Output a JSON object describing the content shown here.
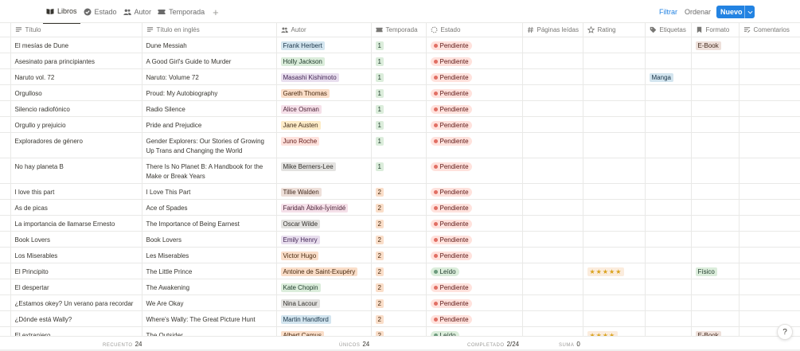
{
  "views": [
    {
      "label": "Libros",
      "icon": "book-open-icon",
      "active": true
    },
    {
      "label": "Estado",
      "icon": "check-circle-icon",
      "active": false
    },
    {
      "label": "Autor",
      "icon": "people-icon",
      "active": false
    },
    {
      "label": "Temporada",
      "icon": "ticket-icon",
      "active": false
    }
  ],
  "add_view_label": "+",
  "actions": {
    "filter": "Filtrar",
    "sort": "Ordenar",
    "new": "Nuevo"
  },
  "columns": [
    {
      "label": "Título",
      "icon": "text-lines-icon"
    },
    {
      "label": "Título en inglés",
      "icon": "text-lines-icon"
    },
    {
      "label": "Autor",
      "icon": "people-icon"
    },
    {
      "label": "Temporada",
      "icon": "ticket-icon"
    },
    {
      "label": "Estado",
      "icon": "status-dashed-circle-icon"
    },
    {
      "label": "Páginas leídas",
      "icon": "hash-icon"
    },
    {
      "label": "Rating",
      "icon": "star-icon"
    },
    {
      "label": "Etiquetas",
      "icon": "tag-icon"
    },
    {
      "label": "Formato",
      "icon": "bookmark-icon"
    },
    {
      "label": "Comentarios",
      "icon": "comment-lines-icon"
    }
  ],
  "colors": {
    "author_tags": {
      "blue": {
        "bg": "#d3e5ef",
        "fg": "#183347"
      },
      "green": {
        "bg": "#dbeddb",
        "fg": "#1c3829"
      },
      "purple": {
        "bg": "#e8deee",
        "fg": "#412454"
      },
      "orange": {
        "bg": "#fadec9",
        "fg": "#49290e"
      },
      "pink": {
        "bg": "#f5e0e9",
        "fg": "#4c2337"
      },
      "yellow": {
        "bg": "#fdecc8",
        "fg": "#402c1b"
      },
      "red": {
        "bg": "#ffe2dd",
        "fg": "#5d1715"
      },
      "gray": {
        "bg": "#e3e2e0",
        "fg": "#32302c"
      },
      "brown": {
        "bg": "#eee0da",
        "fg": "#442a1e"
      }
    },
    "season": {
      "1": {
        "bg": "#dbeddb",
        "fg": "#1c3829"
      },
      "2": {
        "bg": "#fadec9",
        "fg": "#49290e"
      }
    },
    "status": {
      "Pendiente": {
        "bg": "#ffe2dd",
        "fg": "#5d1715",
        "dot": "#e16f64"
      },
      "Leído": {
        "bg": "#dbeddb",
        "fg": "#1c3829",
        "dot": "#6c9b7d"
      }
    },
    "label_tag": {
      "bg": "#d3e5ef",
      "fg": "#183347"
    },
    "format": {
      "E-Book": {
        "bg": "#eee0da",
        "fg": "#442a1e"
      },
      "Físico": {
        "bg": "#dbeddb",
        "fg": "#1c3829"
      }
    }
  },
  "rows": [
    {
      "titulo": "El mesías de Dune",
      "ingles": "Dune Messiah",
      "autor": "Frank Herbert",
      "autor_color": "blue",
      "temporada": "1",
      "estado": "Pendiente",
      "paginas": "",
      "rating": "",
      "etiquetas": "",
      "formato": "E-Book",
      "comentarios": ""
    },
    {
      "titulo": "Asesinato para principiantes",
      "ingles": "A Good Girl's Guide to Murder",
      "autor": "Holly Jackson",
      "autor_color": "green",
      "temporada": "1",
      "estado": "Pendiente",
      "paginas": "",
      "rating": "",
      "etiquetas": "",
      "formato": "",
      "comentarios": ""
    },
    {
      "titulo": "Naruto vol. 72",
      "ingles": "Naruto: Volume 72",
      "autor": "Masashi Kishimoto",
      "autor_color": "purple",
      "temporada": "1",
      "estado": "Pendiente",
      "paginas": "",
      "rating": "",
      "etiquetas": "Manga",
      "formato": "",
      "comentarios": ""
    },
    {
      "titulo": "Orgulloso",
      "ingles": "Proud: My Autobiography",
      "autor": "Gareth Thomas",
      "autor_color": "orange",
      "temporada": "1",
      "estado": "Pendiente",
      "paginas": "",
      "rating": "",
      "etiquetas": "",
      "formato": "",
      "comentarios": ""
    },
    {
      "titulo": "Silencio radiofónico",
      "ingles": "Radio Silence",
      "autor": "Alice Osman",
      "autor_color": "pink",
      "temporada": "1",
      "estado": "Pendiente",
      "paginas": "",
      "rating": "",
      "etiquetas": "",
      "formato": "",
      "comentarios": ""
    },
    {
      "titulo": "Orgullo y prejuicio",
      "ingles": "Pride and Prejudice",
      "autor": "Jane Austen",
      "autor_color": "yellow",
      "temporada": "1",
      "estado": "Pendiente",
      "paginas": "",
      "rating": "",
      "etiquetas": "",
      "formato": "",
      "comentarios": ""
    },
    {
      "titulo": "Exploradores de género",
      "ingles": "Gender Explorers: Our Stories of Growing Up Trans and Changing the World",
      "autor": "Juno Roche",
      "autor_color": "red",
      "temporada": "1",
      "estado": "Pendiente",
      "paginas": "",
      "rating": "",
      "etiquetas": "",
      "formato": "",
      "comentarios": "",
      "tall": true
    },
    {
      "titulo": "No hay planeta B",
      "ingles": "There Is No Planet B: A Handbook for the Make or Break Years",
      "autor": "Mike Berners-Lee",
      "autor_color": "gray",
      "temporada": "1",
      "estado": "Pendiente",
      "paginas": "",
      "rating": "",
      "etiquetas": "",
      "formato": "",
      "comentarios": "",
      "tall": true
    },
    {
      "titulo": "I love this part",
      "ingles": "I Love This Part",
      "autor": "Tillie Walden",
      "autor_color": "brown",
      "temporada": "2",
      "estado": "Pendiente",
      "paginas": "",
      "rating": "",
      "etiquetas": "",
      "formato": "",
      "comentarios": ""
    },
    {
      "titulo": "As de picas",
      "ingles": "Ace of Spades",
      "autor": "Faridah Àbíké-Íyímídé",
      "autor_color": "pink",
      "temporada": "2",
      "estado": "Pendiente",
      "paginas": "",
      "rating": "",
      "etiquetas": "",
      "formato": "",
      "comentarios": ""
    },
    {
      "titulo": "La importancia de llamarse Ernesto",
      "ingles": "The Importance of Being Earnest",
      "autor": "Oscar Wilde",
      "autor_color": "gray",
      "temporada": "2",
      "estado": "Pendiente",
      "paginas": "",
      "rating": "",
      "etiquetas": "",
      "formato": "",
      "comentarios": ""
    },
    {
      "titulo": "Book Lovers",
      "ingles": "Book Lovers",
      "autor": "Emily Henry",
      "autor_color": "purple",
      "temporada": "2",
      "estado": "Pendiente",
      "paginas": "",
      "rating": "",
      "etiquetas": "",
      "formato": "",
      "comentarios": ""
    },
    {
      "titulo": "Los Miserables",
      "ingles": "Les Miserables",
      "autor": "Victor Hugo",
      "autor_color": "orange",
      "temporada": "2",
      "estado": "Pendiente",
      "paginas": "",
      "rating": "",
      "etiquetas": "",
      "formato": "",
      "comentarios": ""
    },
    {
      "titulo": "El Principito",
      "ingles": "The Little Prince",
      "autor": "Antoine de Saint-Exupéry",
      "autor_color": "orange",
      "temporada": "2",
      "estado": "Leído",
      "paginas": "",
      "rating": "★★★★★",
      "etiquetas": "",
      "formato": "Físico",
      "comentarios": ""
    },
    {
      "titulo": "El despertar",
      "ingles": "The Awakening",
      "autor": "Kate Chopin",
      "autor_color": "green",
      "temporada": "2",
      "estado": "Pendiente",
      "paginas": "",
      "rating": "",
      "etiquetas": "",
      "formato": "",
      "comentarios": ""
    },
    {
      "titulo": "¿Estamos okey? Un verano para recordar",
      "ingles": "We Are Okay",
      "autor": "Nina Lacour",
      "autor_color": "gray",
      "temporada": "2",
      "estado": "Pendiente",
      "paginas": "",
      "rating": "",
      "etiquetas": "",
      "formato": "",
      "comentarios": ""
    },
    {
      "titulo": "¿Dónde está Wally?",
      "ingles": "Where's Wally: The Great Picture Hunt",
      "autor": "Martin Handford",
      "autor_color": "blue",
      "temporada": "2",
      "estado": "Pendiente",
      "paginas": "",
      "rating": "",
      "etiquetas": "",
      "formato": "",
      "comentarios": ""
    },
    {
      "titulo": "El extranjero",
      "ingles": "The Outsider",
      "autor": "Albert Camus",
      "autor_color": "orange",
      "temporada": "2",
      "estado": "Leído",
      "paginas": "",
      "rating": "★★★★",
      "etiquetas": "",
      "formato": "E-Book",
      "comentarios": ""
    }
  ],
  "footer": {
    "recuento_label": "RECUENTO",
    "recuento_value": "24",
    "unicos_label": "ÚNICOS",
    "unicos_value": "24",
    "completado_label": "COMPLETADO",
    "completado_value": "2/24",
    "suma_label": "SUMA",
    "suma_value": "0"
  },
  "help_label": "?"
}
